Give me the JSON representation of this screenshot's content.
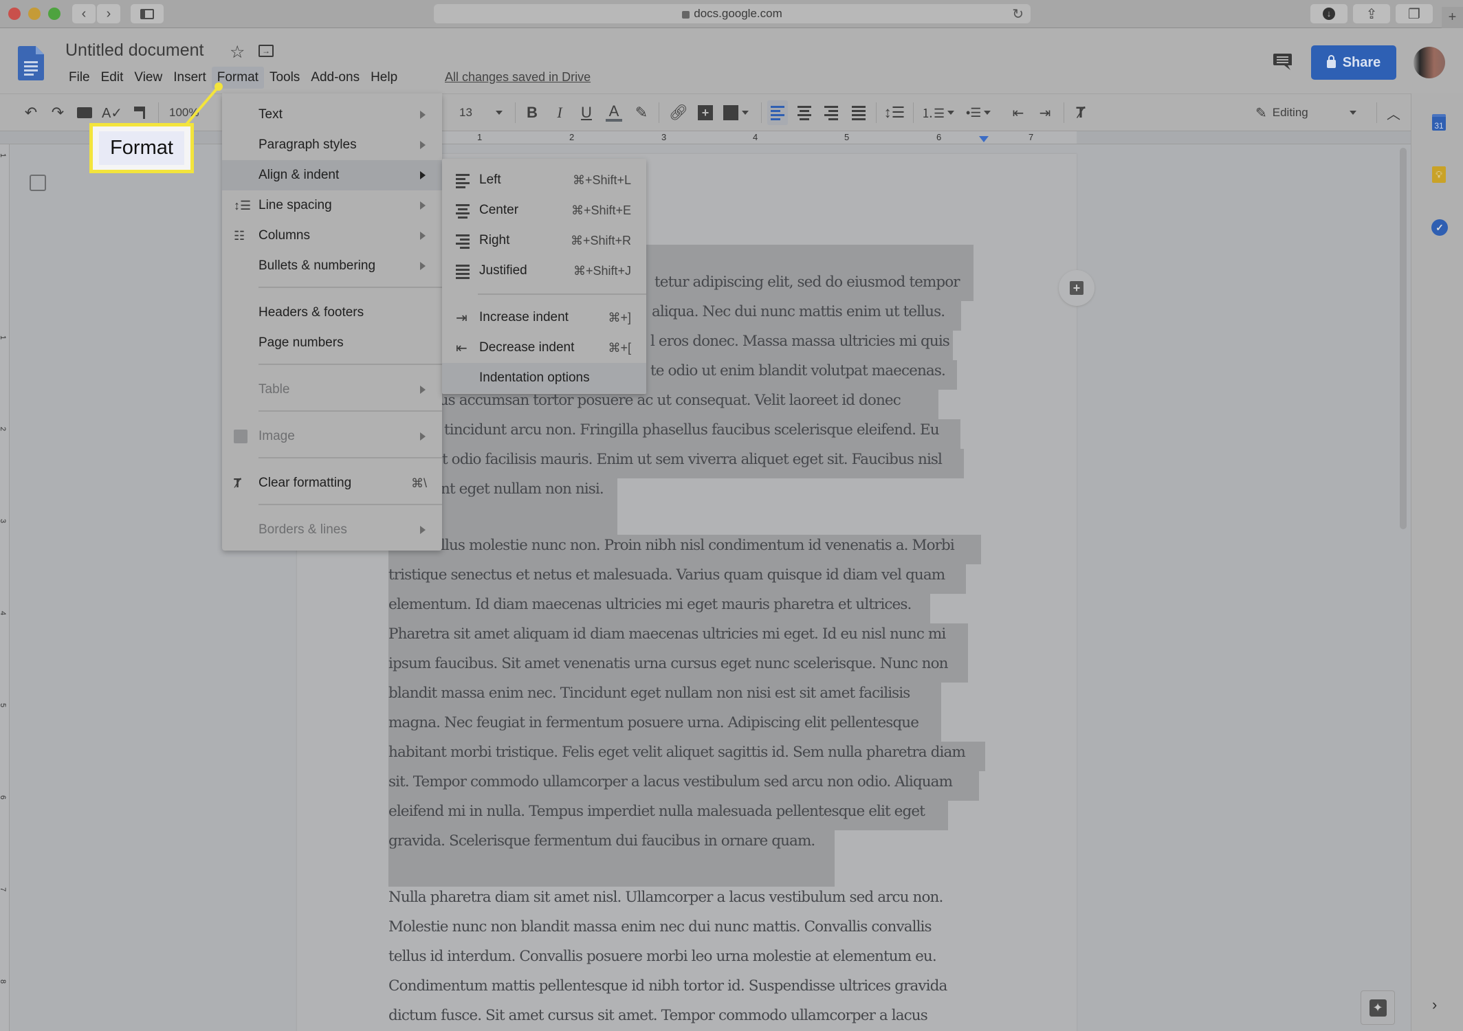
{
  "browser": {
    "url": "docs.google.com",
    "buttons": [
      "back",
      "forward",
      "sidebar",
      "downloads",
      "share",
      "tabs",
      "new-tab"
    ]
  },
  "docs": {
    "title": "Untitled document",
    "menus": [
      "File",
      "Edit",
      "View",
      "Insert",
      "Format",
      "Tools",
      "Add-ons",
      "Help"
    ],
    "active_menu": "Format",
    "save_status": "All changes saved in Drive",
    "share_label": "Share",
    "accent_color": "#2e60b4"
  },
  "toolbar": {
    "zoom": "100%",
    "font_size": "13",
    "mode": "Editing"
  },
  "ruler": {
    "numbers": [
      "1",
      "2",
      "3",
      "4",
      "5",
      "6",
      "7"
    ],
    "vertical_numbers": [
      "1",
      "1",
      "2",
      "3",
      "4",
      "5",
      "6",
      "7",
      "8"
    ]
  },
  "callout": {
    "label": "Format",
    "color": "#f3e43c"
  },
  "format_menu": {
    "items": [
      {
        "label": "Text",
        "submenu": true,
        "icon": ""
      },
      {
        "label": "Paragraph styles",
        "submenu": true,
        "icon": ""
      },
      {
        "label": "Align & indent",
        "submenu": true,
        "icon": "",
        "highlighted": true
      },
      {
        "label": "Line spacing",
        "submenu": true,
        "icon": "line-spacing-icon"
      },
      {
        "label": "Columns",
        "submenu": true,
        "icon": "columns-icon"
      },
      {
        "label": "Bullets & numbering",
        "submenu": true,
        "icon": ""
      },
      {
        "label": "Headers & footers",
        "submenu": false,
        "icon": ""
      },
      {
        "label": "Page numbers",
        "submenu": false,
        "icon": ""
      },
      {
        "label": "Table",
        "submenu": true,
        "disabled": true,
        "icon": ""
      },
      {
        "label": "Image",
        "submenu": true,
        "disabled": true,
        "icon": "image-icon"
      },
      {
        "label": "Clear formatting",
        "shortcut": "⌘\\",
        "icon": "clear-formatting-icon"
      },
      {
        "label": "Borders & lines",
        "submenu": true,
        "disabled": true,
        "icon": ""
      }
    ]
  },
  "align_submenu": {
    "items": [
      {
        "label": "Left",
        "shortcut": "⌘+Shift+L",
        "icon": "align-left-icon"
      },
      {
        "label": "Center",
        "shortcut": "⌘+Shift+E",
        "icon": "align-center-icon"
      },
      {
        "label": "Right",
        "shortcut": "⌘+Shift+R",
        "icon": "align-right-icon"
      },
      {
        "label": "Justified",
        "shortcut": "⌘+Shift+J",
        "icon": "align-justify-icon"
      },
      {
        "label": "Increase indent",
        "shortcut": "⌘+]",
        "icon": "increase-indent-icon"
      },
      {
        "label": "Decrease indent",
        "shortcut": "⌘+[",
        "icon": "decrease-indent-icon"
      },
      {
        "label": "Indentation options",
        "shortcut": "",
        "icon": "",
        "highlighted": true
      }
    ]
  },
  "document": {
    "paragraph1": [
      "tetur adipiscing elit, sed do eiusmod tempor",
      "aliqua. Nec dui nunc mattis enim ut tellus.",
      "l eros donec. Massa massa ultricies mi quis",
      "te odio ut enim blandit volutpat maecenas.",
      "ectus accumsan tortor posuere ac ut consequat. Velit laoreet id donec",
      "tincidunt arcu non. Fringilla phasellus faucibus scelerisque eleifend. Eu",
      "t odio facilisis mauris. Enim ut sem viverra aliquet eget sit. Faucibus nisl",
      "nt eget nullam non nisi."
    ],
    "paragraph2": [
      "llus molestie nunc non. Proin nibh nisl condimentum id venenatis a. Morbi",
      "tristique senectus et netus et malesuada. Varius quam quisque id diam vel quam",
      "elementum. Id diam maecenas ultricies mi eget mauris pharetra et ultrices.",
      "Pharetra sit amet aliquam id diam maecenas ultricies mi eget. Id eu nisl nunc mi",
      "ipsum faucibus. Sit amet venenatis urna cursus eget nunc scelerisque. Nunc non",
      "blandit massa enim nec. Tincidunt eget nullam non nisi est sit amet facilisis",
      "magna. Nec feugiat in fermentum posuere urna. Adipiscing elit pellentesque",
      "habitant morbi tristique. Felis eget velit aliquet sagittis id. Sem nulla pharetra diam",
      "sit. Tempor commodo ullamcorper a lacus vestibulum sed arcu non odio. Aliquam",
      "eleifend mi in nulla. Tempus imperdiet nulla malesuada pellentesque elit eget",
      "gravida. Scelerisque fermentum dui faucibus in ornare quam."
    ],
    "paragraph3": [
      "Nulla pharetra diam sit amet nisl. Ullamcorper a lacus vestibulum sed arcu non.",
      "Molestie nunc non blandit massa enim nec dui nunc mattis. Convallis convallis",
      "tellus id interdum. Convallis posuere morbi leo urna molestie at elementum eu.",
      "Condimentum mattis pellentesque id nibh tortor id. Suspendisse ultrices gravida",
      "dictum fusce. Sit amet cursus sit amet. Tempor commodo ullamcorper a lacus"
    ]
  },
  "side_panel": {
    "calendar_day": "31",
    "apps": [
      "calendar",
      "keep",
      "tasks"
    ]
  }
}
